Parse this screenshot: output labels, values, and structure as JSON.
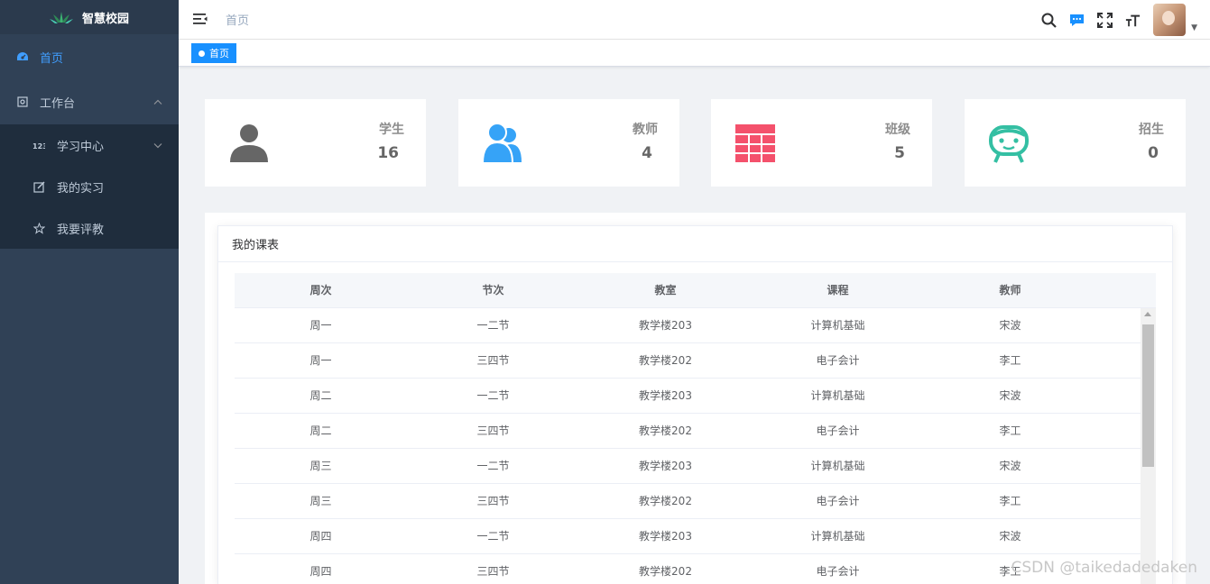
{
  "sidebar": {
    "logo_text": "智慧校园",
    "items": [
      {
        "label": "首页",
        "icon": "dashboard-icon"
      },
      {
        "label": "工作台",
        "icon": "workbench-icon"
      }
    ],
    "submenu": [
      {
        "label": "学习中心",
        "icon": "number-icon"
      },
      {
        "label": "我的实习",
        "icon": "edit-icon"
      },
      {
        "label": "我要评教",
        "icon": "star-icon"
      }
    ]
  },
  "header": {
    "breadcrumb": "首页",
    "tag": "首页"
  },
  "stats": [
    {
      "label": "学生",
      "value": "16",
      "icon": "student-icon",
      "color": "#666666"
    },
    {
      "label": "教师",
      "value": "4",
      "icon": "teachers-icon",
      "color": "#36a3f7"
    },
    {
      "label": "班级",
      "value": "5",
      "icon": "class-grid-icon",
      "color": "#f4516c"
    },
    {
      "label": "招生",
      "value": "0",
      "icon": "enrollment-robot-icon",
      "color": "#34bfa3"
    }
  ],
  "schedule": {
    "title": "我的课表",
    "columns": [
      "周次",
      "节次",
      "教室",
      "课程",
      "教师"
    ],
    "rows": [
      [
        "周一",
        "一二节",
        "教学楼203",
        "计算机基础",
        "宋波"
      ],
      [
        "周一",
        "三四节",
        "教学楼202",
        "电子会计",
        "李工"
      ],
      [
        "周二",
        "一二节",
        "教学楼203",
        "计算机基础",
        "宋波"
      ],
      [
        "周二",
        "三四节",
        "教学楼202",
        "电子会计",
        "李工"
      ],
      [
        "周三",
        "一二节",
        "教学楼203",
        "计算机基础",
        "宋波"
      ],
      [
        "周三",
        "三四节",
        "教学楼202",
        "电子会计",
        "李工"
      ],
      [
        "周四",
        "一二节",
        "教学楼203",
        "计算机基础",
        "宋波"
      ],
      [
        "周四",
        "三四节",
        "教学楼202",
        "电子会计",
        "李工"
      ]
    ]
  },
  "watermark": "CSDN @taikedadedaken",
  "colors": {
    "accent": "#409eff",
    "sidebar": "#304156"
  }
}
